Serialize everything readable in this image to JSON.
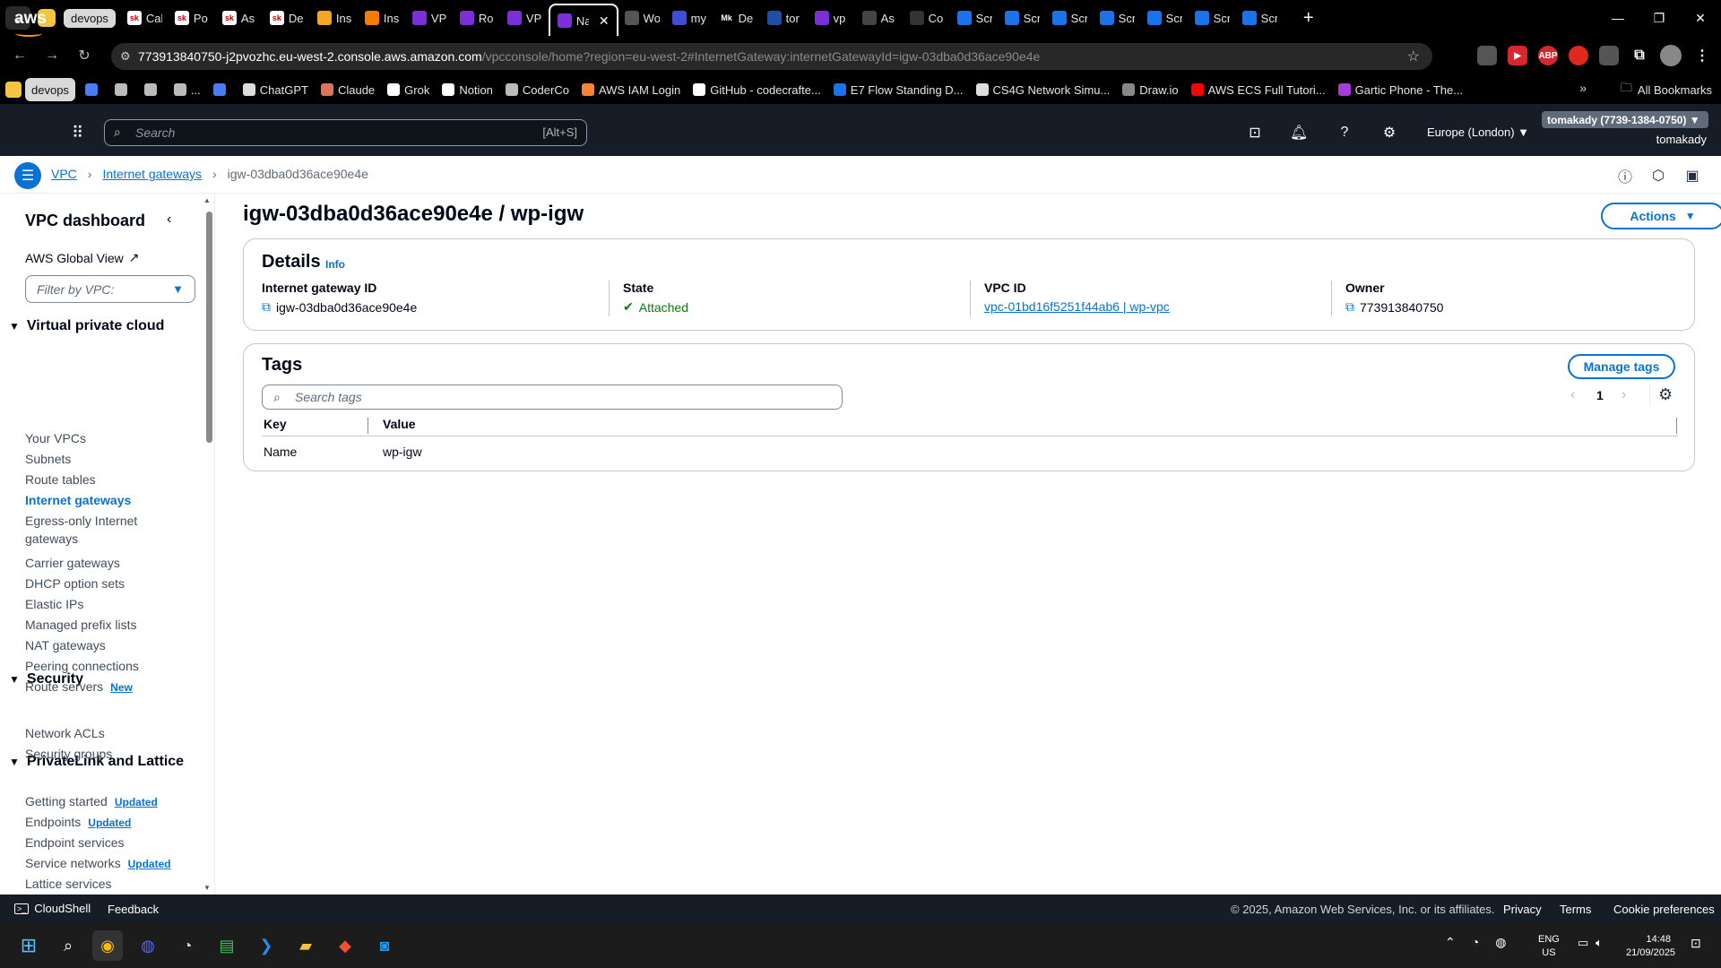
{
  "browser": {
    "group_chip": "devops",
    "tabs": [
      {
        "label": "Cal",
        "fav": "sk",
        "color": "#ffffff"
      },
      {
        "label": "Po",
        "fav": "sk",
        "color": "#ffffff"
      },
      {
        "label": "As",
        "fav": "sk",
        "color": "#ffffff"
      },
      {
        "label": "De",
        "fav": "sk",
        "color": "#ffffff"
      },
      {
        "label": "Ins",
        "fav": "",
        "color": "#f5a623"
      },
      {
        "label": "Ins",
        "fav": "",
        "color": "#f57c00"
      },
      {
        "label": "VP",
        "fav": "",
        "color": "#7b2fd6"
      },
      {
        "label": "Ro",
        "fav": "",
        "color": "#7b2fd6"
      },
      {
        "label": "VP",
        "fav": "",
        "color": "#7b2fd6"
      },
      {
        "label": "Na",
        "fav": "",
        "color": "#7b2fd6"
      },
      {
        "label": "Wo",
        "fav": "",
        "color": "#555555"
      },
      {
        "label": "my",
        "fav": "",
        "color": "#3f4ed6"
      },
      {
        "label": "De",
        "fav": "Mk",
        "color": "#000000"
      },
      {
        "label": "tor",
        "fav": "",
        "color": "#1d4ea8"
      },
      {
        "label": "vp",
        "fav": "",
        "color": "#7b2fd6"
      },
      {
        "label": "As",
        "fav": "",
        "color": "#444444"
      },
      {
        "label": "Co",
        "fav": "",
        "color": "#333333"
      },
      {
        "label": "Scr",
        "fav": "",
        "color": "#1a73e8"
      },
      {
        "label": "Scr",
        "fav": "",
        "color": "#1a73e8"
      },
      {
        "label": "Scr",
        "fav": "",
        "color": "#1a73e8"
      },
      {
        "label": "Scr",
        "fav": "",
        "color": "#1a73e8"
      },
      {
        "label": "Scr",
        "fav": "",
        "color": "#1a73e8"
      },
      {
        "label": "Scr",
        "fav": "",
        "color": "#1a73e8"
      },
      {
        "label": "Scr",
        "fav": "",
        "color": "#1a73e8"
      }
    ],
    "active_tab_index": 9,
    "url_host": "773913840750-j2pvozhc.eu-west-2.console.aws.amazon.com",
    "url_path": "/vpcconsole/home?region=eu-west-2#InternetGateway:internetGatewayId=igw-03dba0d36ace90e4e",
    "bookmarks_chip": "devops",
    "bookmarks": [
      {
        "label": "",
        "color": "#4a7cf7"
      },
      {
        "label": "",
        "color": "#bbbbbb"
      },
      {
        "label": "",
        "color": "#bbbbbb"
      },
      {
        "label": "...",
        "color": "#bbbbbb"
      },
      {
        "label": "",
        "color": "#4a7cf7"
      },
      {
        "label": "ChatGPT",
        "color": "#dddddd"
      },
      {
        "label": "Claude",
        "color": "#d97757"
      },
      {
        "label": "Grok",
        "color": "#ffffff"
      },
      {
        "label": "Notion",
        "color": "#ffffff"
      },
      {
        "label": "CoderCo",
        "color": "#bbbbbb"
      },
      {
        "label": "AWS IAM Login",
        "color": "#f58536"
      },
      {
        "label": "GitHub - codecrafte...",
        "color": "#ffffff"
      },
      {
        "label": "E7 Flow Standing D...",
        "color": "#1a73e8"
      },
      {
        "label": "CS4G Network Simu...",
        "color": "#dddddd"
      },
      {
        "label": "Draw.io",
        "color": "#888888"
      },
      {
        "label": "AWS ECS Full Tutori...",
        "color": "#ff0000"
      },
      {
        "label": "Gartic Phone - The...",
        "color": "#a23fd6"
      }
    ],
    "all_bookmarks": "All Bookmarks"
  },
  "aws": {
    "search_placeholder": "Search",
    "search_shortcut": "[Alt+S]",
    "region": "Europe (London) ▼",
    "account": "tomakady (7739-1384-0750) ▼",
    "user": "tomakady"
  },
  "breadcrumbs": {
    "vpc": "VPC",
    "igws": "Internet gateways",
    "current": "igw-03dba0d36ace90e4e"
  },
  "sidebar": {
    "title": "VPC dashboard",
    "global_view": "AWS Global View",
    "filter_placeholder": "Filter by VPC:",
    "sections": {
      "vpc": "Virtual private cloud",
      "security": "Security",
      "privatelink": "PrivateLink and Lattice"
    },
    "items": [
      {
        "label": "Your VPCs",
        "badge": ""
      },
      {
        "label": "Subnets",
        "badge": ""
      },
      {
        "label": "Route tables",
        "badge": ""
      },
      {
        "label": "Internet gateways",
        "badge": ""
      },
      {
        "label": "Egress-only Internet gateways",
        "badge": ""
      },
      {
        "label": "Carrier gateways",
        "badge": ""
      },
      {
        "label": "DHCP option sets",
        "badge": ""
      },
      {
        "label": "Elastic IPs",
        "badge": ""
      },
      {
        "label": "Managed prefix lists",
        "badge": ""
      },
      {
        "label": "NAT gateways",
        "badge": ""
      },
      {
        "label": "Peering connections",
        "badge": ""
      },
      {
        "label": "Route servers",
        "badge": "New"
      },
      {
        "label": "Network ACLs",
        "badge": ""
      },
      {
        "label": "Security groups",
        "badge": ""
      },
      {
        "label": "Getting started",
        "badge": "Updated"
      },
      {
        "label": "Endpoints",
        "badge": "Updated"
      },
      {
        "label": "Endpoint services",
        "badge": ""
      },
      {
        "label": "Service networks",
        "badge": "Updated"
      },
      {
        "label": "Lattice services",
        "badge": ""
      }
    ]
  },
  "main": {
    "title": "igw-03dba0d36ace90e4e / wp-igw",
    "actions": "Actions",
    "details": {
      "title": "Details",
      "info": "Info",
      "igw_label": "Internet gateway ID",
      "igw_value": "igw-03dba0d36ace90e4e",
      "state_label": "State",
      "state_value": "Attached",
      "vpc_label": "VPC ID",
      "vpc_value": "vpc-01bd16f5251f44ab6 | wp-vpc",
      "owner_label": "Owner",
      "owner_value": "773913840750"
    },
    "tags": {
      "title": "Tags",
      "manage": "Manage tags",
      "search_placeholder": "Search tags",
      "page": "1",
      "col_key": "Key",
      "col_value": "Value",
      "rows": [
        {
          "key": "Name",
          "value": "wp-igw"
        }
      ]
    }
  },
  "footer": {
    "cloudshell": "CloudShell",
    "feedback": "Feedback",
    "copyright": "© 2025, Amazon Web Services, Inc. or its affiliates.",
    "privacy": "Privacy",
    "terms": "Terms",
    "cookies": "Cookie preferences"
  },
  "taskbar": {
    "lang1": "ENG",
    "lang2": "US",
    "time": "14:48",
    "date": "21/09/2025"
  }
}
